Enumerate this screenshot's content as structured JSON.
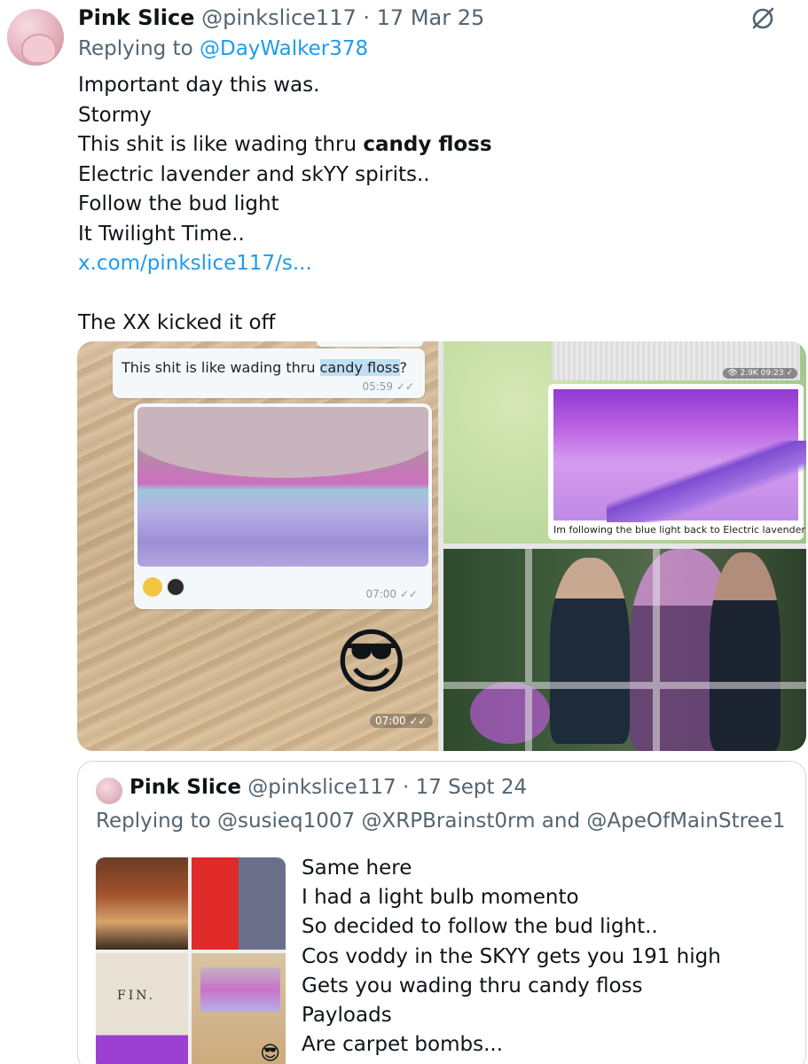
{
  "tweet": {
    "author_name": "Pink Slice",
    "author_handle": "@pinkslice117",
    "separator": "·",
    "date": "17 Mar 25",
    "replying_prefix": "Replying to",
    "replying_to": "@DayWalker378",
    "text_lines": [
      "Important day this was.",
      "Stormy"
    ],
    "line3_prefix": "This shit is like wading thru ",
    "line3_bold": "candy floss",
    "text_lines_after": [
      "Electric lavender and skYY spirits..",
      "Follow the bud light",
      "It Twilight Time.."
    ],
    "link": "x.com/pinkslice117/s...",
    "closing_line": "The XX kicked it off"
  },
  "media": {
    "chat_bubble_text_prefix": "This shit is like wading thru ",
    "chat_bubble_highlight": "candy floss",
    "chat_bubble_suffix": "?",
    "chat_bubble_time": "05:59 ✓✓",
    "photo_bubble_time": "07:00 ✓✓",
    "emoji_sticker": "😎",
    "sticker_time": "07:00 ✓✓",
    "top_right_views": "👁 2.9K 09:23 ✓",
    "top_right_caption": "Im following the blue light back to Electric lavender"
  },
  "quote": {
    "author_name": "Pink Slice",
    "author_handle": "@pinkslice117",
    "separator": "·",
    "date": "17 Sept 24",
    "replying_line": "Replying to @susieq1007 @XRPBrainst0rm and @ApeOfMainStree1",
    "thumb_text": "FIN.",
    "thumb_emoji": "😎",
    "text_lines": [
      "Same here",
      "I had a light bulb momento",
      "So decided to follow the bud light..",
      "Cos voddy in the SKYY gets you 191 high",
      "Gets you wading thru candy floss",
      "Payloads",
      "Are carpet bombs..."
    ]
  },
  "icons": {
    "grok": "grok-icon"
  },
  "colors": {
    "link": "#1d9bf0",
    "secondary_text": "#536471",
    "primary_text": "#0f1419"
  }
}
